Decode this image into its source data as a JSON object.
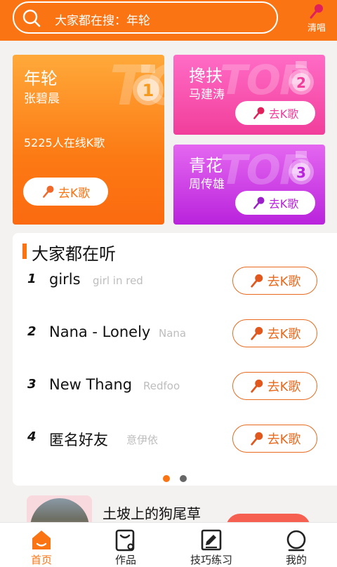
{
  "header": {
    "search_text": "大家都在搜：年轮",
    "qingchang_label": "清唱"
  },
  "top_cards": [
    {
      "rank": "1",
      "watermark": "TOP",
      "title": "年轮",
      "artist": "张碧晨",
      "online": "5225人在线K歌",
      "button": "去K歌"
    },
    {
      "rank": "2",
      "watermark": "TOP",
      "title": "搀扶",
      "artist": "马建涛",
      "button": "去K歌"
    },
    {
      "rank": "3",
      "watermark": "TOP",
      "title": "青花",
      "artist": "周传雄",
      "button": "去K歌"
    }
  ],
  "listening": {
    "title": "大家都在听",
    "songs": [
      {
        "rank": "1",
        "name": "girls",
        "artist": "girl in red",
        "button": "去K歌"
      },
      {
        "rank": "2",
        "name": "Nana - Lonely",
        "artist": "Nana",
        "button": "去K歌"
      },
      {
        "rank": "3",
        "name": "New Thang",
        "artist": "Redfoo",
        "button": "去K歌"
      },
      {
        "rank": "4",
        "name": "匿名好友",
        "artist": "意伊依",
        "button": "去K歌"
      }
    ],
    "page_indicator": {
      "current": 1,
      "total": 2
    }
  },
  "next_item": {
    "title": "土坡上的狗尾草"
  },
  "bottom_nav": {
    "items": [
      {
        "label": "首页",
        "icon": "home-icon",
        "active": true
      },
      {
        "label": "作品",
        "icon": "works-icon",
        "active": false
      },
      {
        "label": "技巧练习",
        "icon": "practice-icon",
        "active": false
      },
      {
        "label": "我的",
        "icon": "profile-icon",
        "active": false
      }
    ]
  },
  "colors": {
    "brand_orange": "#fb7414",
    "pink": "#f13e9b",
    "purple": "#b923dc",
    "button_outline": "#e86a1e"
  }
}
